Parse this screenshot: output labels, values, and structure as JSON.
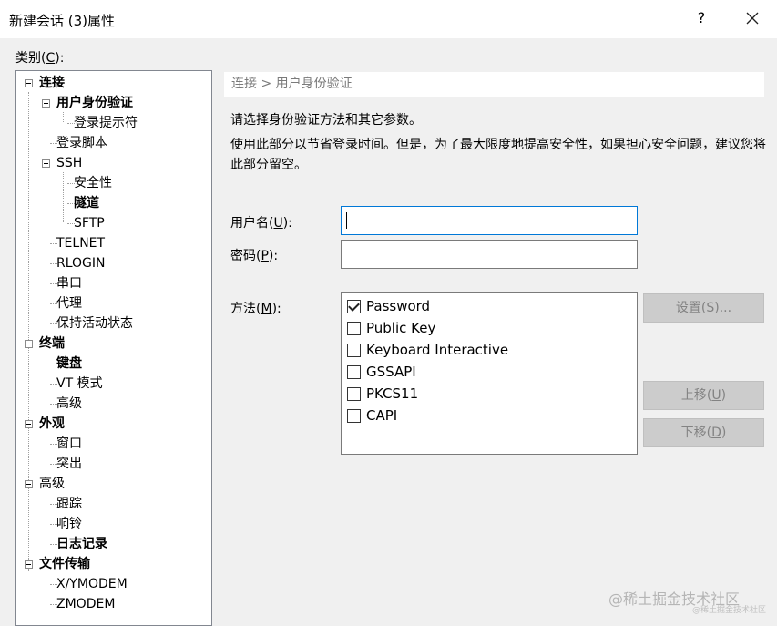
{
  "window": {
    "title": "新建会话 (3)属性",
    "help_label": "?",
    "close_label": "×"
  },
  "category": {
    "label_prefix": "类别(",
    "label_key": "C",
    "label_suffix": "):"
  },
  "tree": {
    "connection": "连接",
    "auth": "用户身份验证",
    "login_prompt": "登录提示符",
    "login_script": "登录脚本",
    "ssh": "SSH",
    "security": "安全性",
    "tunnel": "隧道",
    "sftp": "SFTP",
    "telnet": "TELNET",
    "rlogin": "RLOGIN",
    "serial": "串口",
    "proxy": "代理",
    "keepalive": "保持活动状态",
    "terminal": "终端",
    "keyboard": "键盘",
    "vt_mode": "VT 模式",
    "terminal_advanced": "高级",
    "appearance": "外观",
    "window": "窗口",
    "highlight": "突出",
    "advanced": "高级",
    "trace": "跟踪",
    "bell": "响铃",
    "logging": "日志记录",
    "file_transfer": "文件传输",
    "xymodem": "X/YMODEM",
    "zmodem": "ZMODEM"
  },
  "main": {
    "breadcrumb": "连接 > 用户身份验证",
    "desc1": "请选择身份验证方法和其它参数。",
    "desc2": "使用此部分以节省登录时间。但是，为了最大限度地提高安全性，如果担心安全问题，建议您将此部分留空。",
    "username_label_prefix": "用户名(",
    "username_key": "U",
    "username_label_suffix": "):",
    "username_value": "",
    "password_label_prefix": "密码(",
    "password_key": "P",
    "password_label_suffix": "):",
    "password_value": "",
    "method_label_prefix": "方法(",
    "method_key": "M",
    "method_label_suffix": "):",
    "methods": [
      {
        "label": "Password",
        "checked": true
      },
      {
        "label": "Public Key",
        "checked": false
      },
      {
        "label": "Keyboard Interactive",
        "checked": false
      },
      {
        "label": "GSSAPI",
        "checked": false
      },
      {
        "label": "PKCS11",
        "checked": false
      },
      {
        "label": "CAPI",
        "checked": false
      }
    ],
    "settings_button_prefix": "设置(",
    "settings_key": "S",
    "settings_button_suffix": ")...",
    "move_up_prefix": "上移(",
    "move_up_key": "U",
    "move_up_suffix": ")",
    "move_down_prefix": "下移(",
    "move_down_key": "D",
    "move_down_suffix": ")"
  },
  "watermark": {
    "text": "@稀土掘金技术社区",
    "small": "@稀土掘金技术社区"
  }
}
